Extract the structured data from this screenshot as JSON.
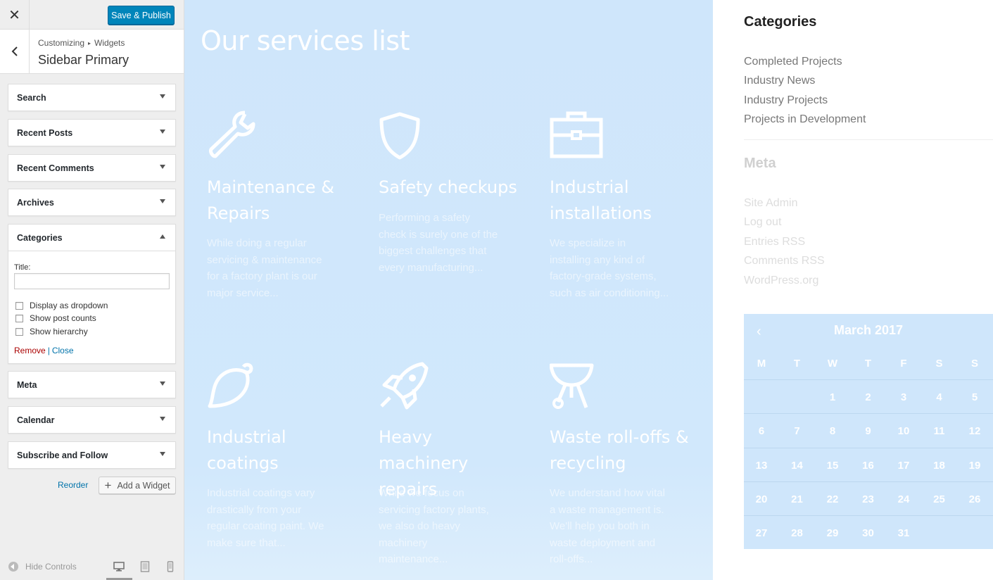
{
  "customizer": {
    "close_icon": "close-icon",
    "publish_label": "Save & Publish",
    "breadcrumb_root": "Customizing",
    "breadcrumb_sep": "▸",
    "breadcrumb_child": "Widgets",
    "section_title": "Sidebar Primary",
    "widgets": [
      {
        "title": "Search"
      },
      {
        "title": "Recent Posts"
      },
      {
        "title": "Recent Comments"
      },
      {
        "title": "Archives"
      },
      {
        "title": "Categories"
      },
      {
        "title": "Meta"
      },
      {
        "title": "Calendar"
      },
      {
        "title": "Subscribe and Follow"
      }
    ],
    "categories_form": {
      "title_label": "Title:",
      "title_value": "",
      "checkboxes": [
        "Display as dropdown",
        "Show post counts",
        "Show hierarchy"
      ],
      "remove_label": "Remove",
      "separator": "|",
      "close_label": "Close"
    },
    "reorder_label": "Reorder",
    "add_widget_label": "Add a Widget",
    "hide_controls_label": "Hide Controls",
    "devices": [
      "desktop-icon",
      "tablet-icon",
      "mobile-icon"
    ],
    "accent": "#0085ba"
  },
  "preview": {
    "services_title": "Our services list",
    "services": [
      {
        "icon": "wrench-icon",
        "title": "Maintenance & Repairs",
        "desc": "While doing a regular servicing & maintenance for a factory plant is our major service..."
      },
      {
        "icon": "shield-icon",
        "title": "Safety checkups",
        "desc": "Performing a safety check is surely one of the biggest challenges that every manufacturing..."
      },
      {
        "icon": "toolbox-icon",
        "title": "Industrial installations",
        "desc": "We specialize in installing any kind of factory-grade systems, such as air conditioning..."
      },
      {
        "icon": "paint-brush-icon",
        "title": "Industrial coatings",
        "desc": "Industrial coatings vary drastically from your regular coating paint. We make sure that..."
      },
      {
        "icon": "rocket-icon",
        "title": "Heavy machinery repairs",
        "desc": "While we focus on servicing factory plants, we also do heavy machinery maintenance..."
      },
      {
        "icon": "grill-icon",
        "title": "Waste roll-offs & recycling",
        "desc": "We understand how vital a waste management is. We'll help you both in waste deployment and roll-offs..."
      }
    ],
    "categories_title": "Categories",
    "categories": [
      "Completed Projects",
      "Industry News",
      "Industry Projects",
      "Projects in Development"
    ],
    "meta_title": "Meta",
    "meta_links": [
      "Site Admin",
      "Log out",
      "Entries RSS",
      "Comments RSS",
      "WordPress.org"
    ],
    "calendar": {
      "prev_label": "‹",
      "month": "March 2017",
      "weekdays": [
        "M",
        "T",
        "W",
        "T",
        "F",
        "S",
        "S"
      ],
      "weeks": [
        [
          "",
          "",
          "1",
          "2",
          "3",
          "4",
          "5"
        ],
        [
          "6",
          "7",
          "8",
          "9",
          "10",
          "11",
          "12"
        ],
        [
          "13",
          "14",
          "15",
          "16",
          "17",
          "18",
          "19"
        ],
        [
          "20",
          "21",
          "22",
          "23",
          "24",
          "25",
          "26"
        ],
        [
          "27",
          "28",
          "29",
          "30",
          "31",
          "",
          ""
        ]
      ]
    }
  }
}
